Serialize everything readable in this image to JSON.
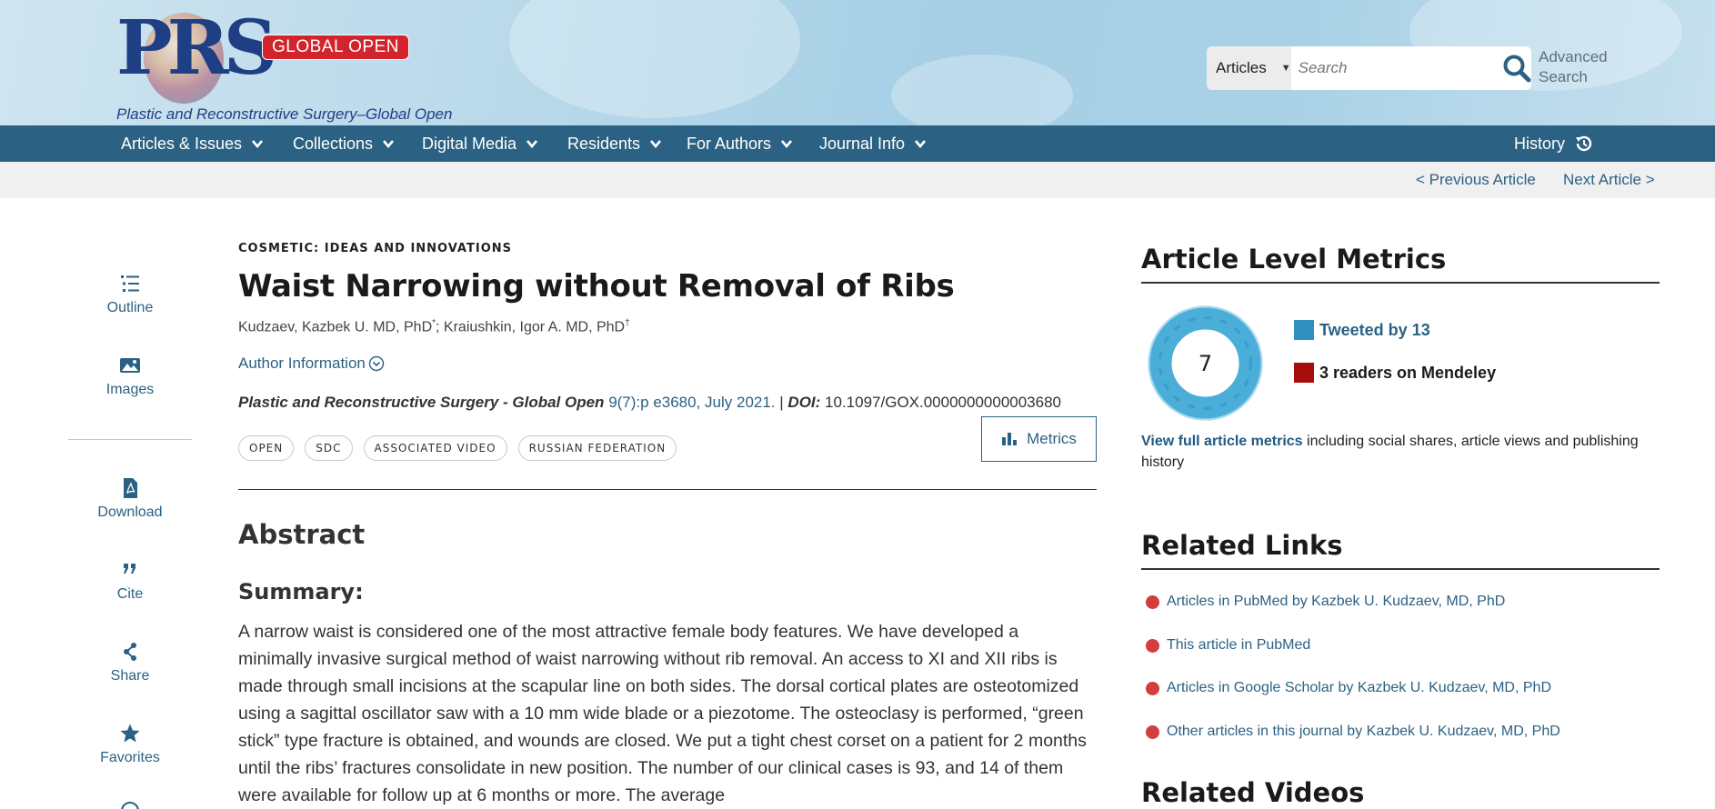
{
  "header": {
    "logo_text": "PRS",
    "logo_badge": "GLOBAL OPEN",
    "tagline": "Plastic and Reconstructive  Surgery–Global Open",
    "search_scope": "Articles",
    "search_placeholder": "Search",
    "advanced_search": "Advanced Search"
  },
  "nav": {
    "items": [
      {
        "label": "Articles & Issues"
      },
      {
        "label": "Collections"
      },
      {
        "label": "Digital Media"
      },
      {
        "label": "Residents"
      },
      {
        "label": "For Authors"
      },
      {
        "label": "Journal Info"
      }
    ],
    "history": "History"
  },
  "subnav": {
    "previous": "< Previous Article",
    "next": "Next Article >"
  },
  "sidebar": {
    "items": [
      {
        "label": "Outline",
        "icon": "outline-icon"
      },
      {
        "label": "Images",
        "icon": "images-icon"
      },
      {
        "label": "Download",
        "icon": "pdf-icon"
      },
      {
        "label": "Cite",
        "icon": "quote-icon"
      },
      {
        "label": "Share",
        "icon": "share-icon"
      },
      {
        "label": "Favorites",
        "icon": "star-icon"
      }
    ]
  },
  "article": {
    "section": "COSMETIC: IDEAS AND INNOVATIONS",
    "title": "Waist Narrowing without Removal of Ribs",
    "author1": "Kudzaev, Kazbek U. MD, PhD",
    "author1_mark": "*",
    "separator": "; ",
    "author2": "Kraiushkin, Igor A. MD, PhD",
    "author2_mark": "†",
    "author_info": "Author Information",
    "journal": "Plastic and Reconstructive Surgery - Global Open",
    "volume": "9(7):p e3680, July 2021.",
    "doi_sep": " | ",
    "doi_label": "DOI:",
    "doi": "10.1097/GOX.0000000000003680",
    "tags": [
      "OPEN",
      "SDC",
      "ASSOCIATED VIDEO",
      "RUSSIAN FEDERATION"
    ],
    "metrics_button": "Metrics",
    "abstract_heading": "Abstract",
    "summary_heading": "Summary:",
    "summary_text": "A narrow waist is considered one of the most attractive female body features. We have developed a minimally invasive surgical method of waist narrowing without rib removal. An access to XI and XII ribs is made through small incisions at the scapular line on both sides. The dorsal cortical plates are osteotomized using a sagittal oscillator saw with a 10 mm wide blade or a piezotome. The osteoclasy is performed, “green stick” type fracture is obtained, and wounds are closed. We put a tight chest corset on a patient for 2 months until the ribs’ fractures consolidate in new position. The number of our clinical cases is 93, and 14 of them were available for follow up at 6 months or more. The average"
  },
  "metrics": {
    "heading": "Article Level Metrics",
    "score": "7",
    "tweeted": "Tweeted by 13",
    "mendeley": "3 readers on Mendeley",
    "full_link": "View full article metrics",
    "full_rest": " including social shares, article views and publishing history",
    "colors": {
      "twitter": "#2f8fbf",
      "mendeley": "#a50c0c",
      "donut": "#4aaed9"
    }
  },
  "related_links": {
    "heading": "Related Links",
    "items": [
      "Articles in PubMed by Kazbek U. Kudzaev, MD, PhD",
      "This article in PubMed",
      "Articles in Google Scholar by Kazbek U. Kudzaev, MD, PhD",
      "Other articles in this journal by Kazbek U. Kudzaev, MD, PhD"
    ]
  },
  "related_videos": {
    "heading": "Related Videos"
  }
}
